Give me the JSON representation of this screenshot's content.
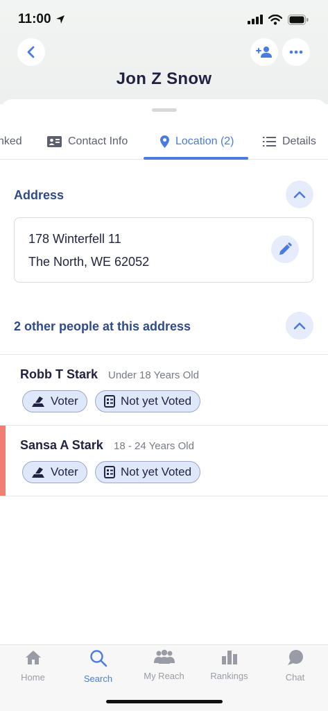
{
  "status_bar": {
    "time": "11:00"
  },
  "header": {
    "title": "Jon Z Snow"
  },
  "tabs": [
    {
      "label": "nked"
    },
    {
      "label": "Contact Info"
    },
    {
      "label": "Location (2)"
    },
    {
      "label": "Details"
    }
  ],
  "address_section": {
    "title": "Address",
    "line1": "178 Winterfell 11",
    "line2": "The North, WE 62052"
  },
  "others_section": {
    "title": "2 other people at this address"
  },
  "people": [
    {
      "name": "Robb T Stark",
      "age": "Under 18 Years Old",
      "chips": [
        "Voter",
        "Not yet Voted"
      ]
    },
    {
      "name": "Sansa A Stark",
      "age": "18 - 24 Years Old",
      "chips": [
        "Voter",
        "Not yet Voted"
      ]
    }
  ],
  "bottom_nav": [
    {
      "label": "Home",
      "icon": "home-icon"
    },
    {
      "label": "Search",
      "icon": "search-icon"
    },
    {
      "label": "My Reach",
      "icon": "people-icon"
    },
    {
      "label": "Rankings",
      "icon": "bar-chart-icon"
    },
    {
      "label": "Chat",
      "icon": "chat-icon"
    }
  ],
  "colors": {
    "accent": "#4a7be0",
    "section_title": "#2f4a8a",
    "alert": "#ef7f73"
  }
}
